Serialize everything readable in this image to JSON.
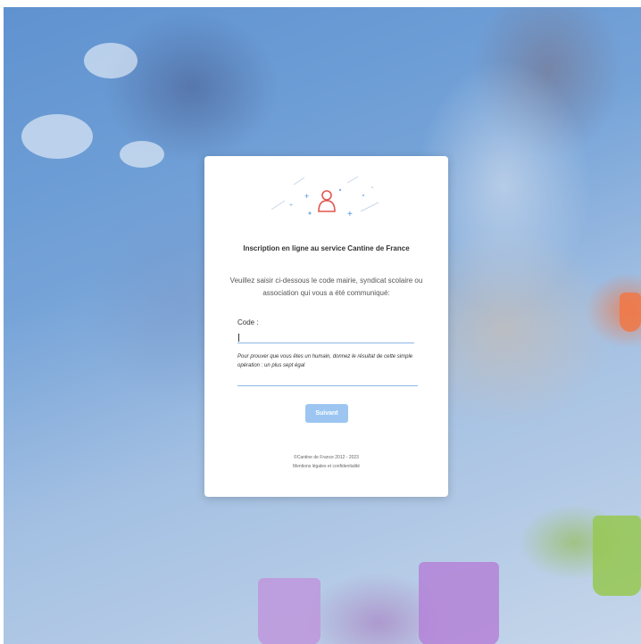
{
  "login_card": {
    "title": "Inscription en ligne au service Cantine de France",
    "subtitle": "Veuillez saisir ci-dessous le code mairie, syndicat scolaire ou association qui vous a été communiqué:",
    "code_label": "Code :",
    "code_value": "",
    "captcha_question": "Pour prouver que vous êtes un humain, donnez le résultat de cette simple opération : un plus sept égal",
    "captcha_value": "",
    "next_button_label": "Suivant",
    "copyright": "©Cantine de France 2012 - 2023",
    "legal_link": "Mentions légales et confidentialité"
  },
  "colors": {
    "accent": "#9cc6f1",
    "logo_red": "#e0574f",
    "logo_blue": "#4a90e2",
    "input_underline": "#8fb6e6"
  },
  "icons": {
    "logo": "person-sparkle-icon"
  }
}
